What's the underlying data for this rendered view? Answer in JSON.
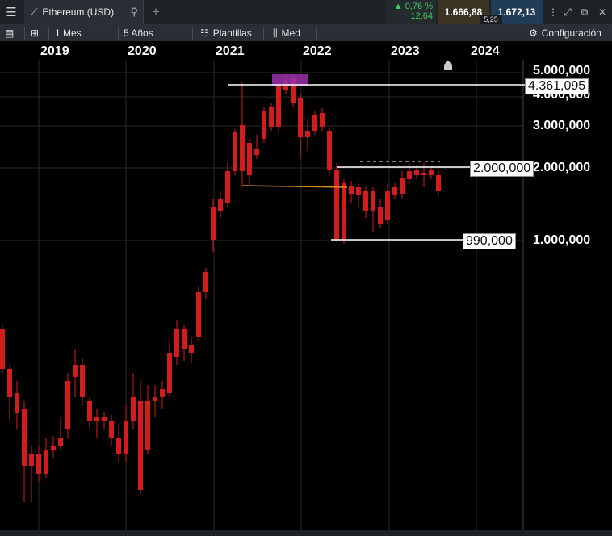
{
  "window": {
    "tab_title": "Ethereum (USD)",
    "change_pct": "▲ 0,76 %",
    "change_abs": "12,64",
    "bid": "1.666,88",
    "ask": "1.672,13",
    "spread": "5,25"
  },
  "toolbar": {
    "period": "1 Mes",
    "range": "5 Años",
    "templates": "Plantillas",
    "price_type": "Med",
    "settings": "Configuración"
  },
  "chart_data": {
    "type": "candlestick",
    "y_scale": "log",
    "x_ticks": [
      "2019",
      "2020",
      "2021",
      "2022",
      "2023",
      "2024"
    ],
    "y_ticks": [
      "5.000,000",
      "4.000,000",
      "3.000,000",
      "2.000,000",
      "1.000,000"
    ],
    "horizontal_levels": [
      "4.361,095",
      "2.000,000",
      "990,000"
    ],
    "colors": {
      "up": "#22c03c",
      "down": "#d41c1c",
      "bg": "#000000",
      "grid": "#2a2a2a",
      "support_line": "#e08a2c",
      "highlight": "#9b2fae"
    }
  }
}
